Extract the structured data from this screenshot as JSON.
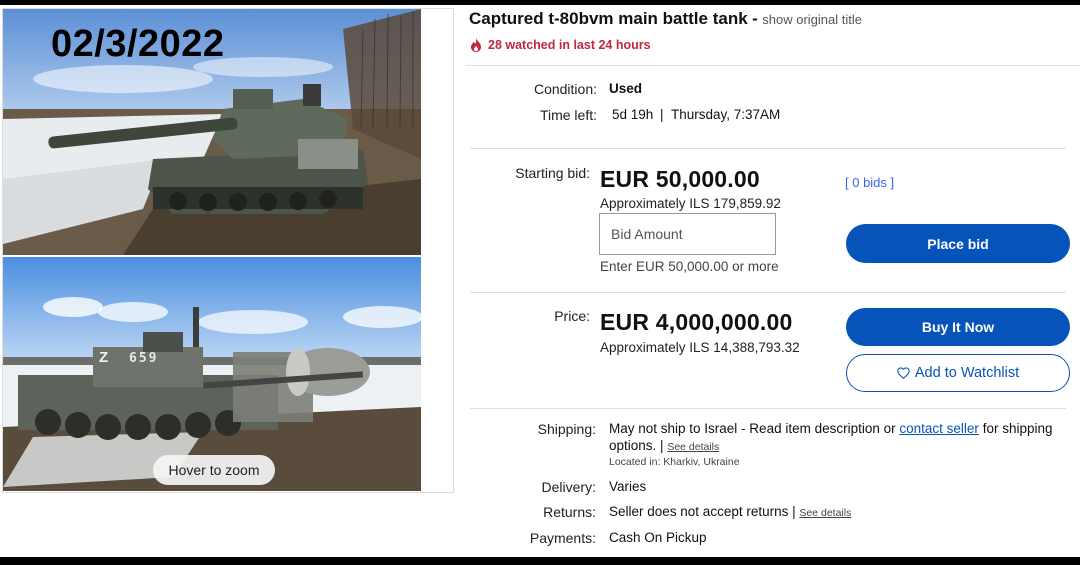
{
  "gallery": {
    "photo_date": "02/3/2022",
    "turret_number": "659",
    "turret_mark": "Z",
    "zoom_hint": "Hover to zoom"
  },
  "listing": {
    "title": "Captured t-80bvm main battle tank",
    "title_separator": "-",
    "original_title_link": "show original title",
    "watch_text": "28 watched in last 24 hours",
    "condition_label": "Condition:",
    "condition_value": "Used",
    "time_left_label": "Time left:",
    "time_left_value": "5d 19h",
    "time_left_separator": "|",
    "end_time": "Thursday, 7:37AM"
  },
  "auction": {
    "starting_bid_label": "Starting bid:",
    "starting_bid_value": "EUR 50,000.00",
    "starting_bid_approx": "Approximately ILS 179,859.92",
    "bids_count": "[ 0 bids ]",
    "bid_placeholder": "Bid Amount",
    "bid_hint": "Enter EUR 50,000.00 or more",
    "place_bid_label": "Place bid"
  },
  "buy_now": {
    "price_label": "Price:",
    "price_value": "EUR 4,000,000.00",
    "price_approx": "Approximately ILS 14,388,793.32",
    "buy_now_label": "Buy It Now",
    "watchlist_label": "Add to Watchlist"
  },
  "shipping": {
    "shipping_label": "Shipping:",
    "shipping_text_a": "May not ship to Israel - Read item description or",
    "contact_seller_link": "contact seller",
    "shipping_text_b": "for shipping",
    "shipping_text_c": "options. |",
    "see_details_1": "See details",
    "located_in": "Located in: Kharkiv, Ukraine",
    "delivery_label": "Delivery:",
    "delivery_value": "Varies",
    "returns_label": "Returns:",
    "returns_value": "Seller does not accept returns |",
    "see_details_2": "See details",
    "payments_label": "Payments:",
    "payments_value": "Cash On Pickup"
  },
  "colors": {
    "primary_button": "#0654ba",
    "link": "#3665f3",
    "watch_red": "#c0283c"
  },
  "icons": [
    "flame-icon",
    "heart-icon"
  ]
}
